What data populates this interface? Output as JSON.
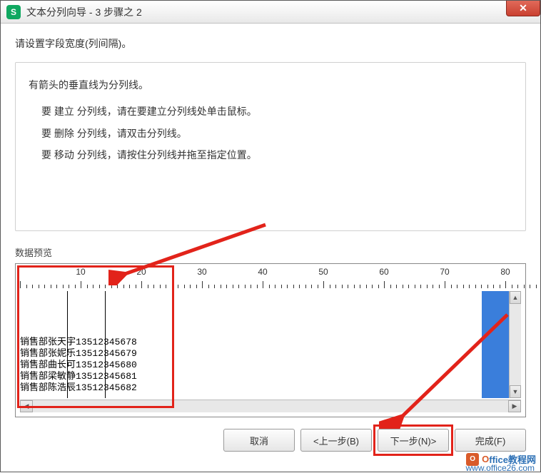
{
  "window": {
    "title": "文本分列向导 - 3 步骤之 2"
  },
  "instruction": "请设置字段宽度(列间隔)。",
  "help": {
    "title": "有箭头的垂直线为分列线。",
    "create": "要 建立 分列线，请在要建立分列线处单击鼠标。",
    "delete": "要 删除 分列线，请双击分列线。",
    "move": "要 移动 分列线，请按住分列线并拖至指定位置。"
  },
  "preview": {
    "label": "数据预览",
    "ruler_marks": [
      10,
      20,
      30,
      40,
      50,
      60,
      70,
      80
    ],
    "divider_positions": [
      5,
      9
    ],
    "rows": [
      {
        "dept": "销售部",
        "name": "张天宇",
        "phone": "13512345678"
      },
      {
        "dept": "销售部",
        "name": "张妮乐",
        "phone": "13512345679"
      },
      {
        "dept": "销售部",
        "name": "曲长可",
        "phone": "13512345680"
      },
      {
        "dept": "销售部",
        "name": "梁敏静",
        "phone": "13512345681"
      },
      {
        "dept": "销售部",
        "name": "陈浩辰",
        "phone": "13512345682"
      }
    ]
  },
  "buttons": {
    "cancel": "取消",
    "prev": "<上一步(B)",
    "next": "下一步(N)>",
    "finish": "完成(F)"
  },
  "watermark": {
    "brand_o": "O",
    "brand_rest": "ffice教程网",
    "url": "www.office26.com"
  }
}
